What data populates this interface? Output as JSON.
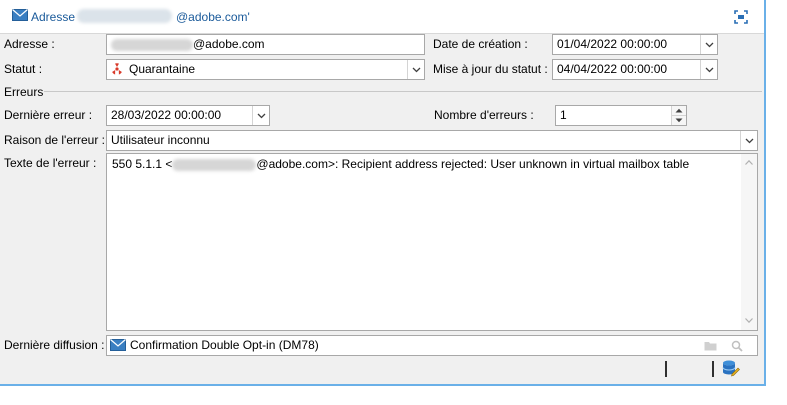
{
  "window": {
    "title_label": "Adresse",
    "title_domain": "@adobe.com'"
  },
  "fields": {
    "adresse_label": "Adresse :",
    "adresse_domain": "@adobe.com",
    "statut_label": "Statut :",
    "statut_value": "Quarantaine",
    "date_creation_label": "Date de création :",
    "date_creation_value": "01/04/2022 00:00:00",
    "maj_statut_label": "Mise à jour du statut :",
    "maj_statut_value": "04/04/2022 00:00:00"
  },
  "errors": {
    "section_label": "Erreurs",
    "derniere_erreur_label": "Dernière erreur :",
    "derniere_erreur_value": "28/03/2022 00:00:00",
    "nombre_erreurs_label": "Nombre d'erreurs :",
    "nombre_erreurs_value": "1",
    "raison_label": "Raison de l'erreur :",
    "raison_value": "Utilisateur inconnu",
    "texte_label": "Texte de l'erreur :",
    "texte_prefix": "550 5.1.1 <",
    "texte_suffix": "@adobe.com>: Recipient address rejected: User unknown in virtual mailbox table"
  },
  "derniere_diffusion": {
    "label": "Dernière diffusion :",
    "value": "Confirmation Double Opt-in (DM78)"
  },
  "colors": {
    "title_link": "#1a5a9a",
    "status_icon": "#d93a2a",
    "window_border": "#6ab0e8"
  }
}
